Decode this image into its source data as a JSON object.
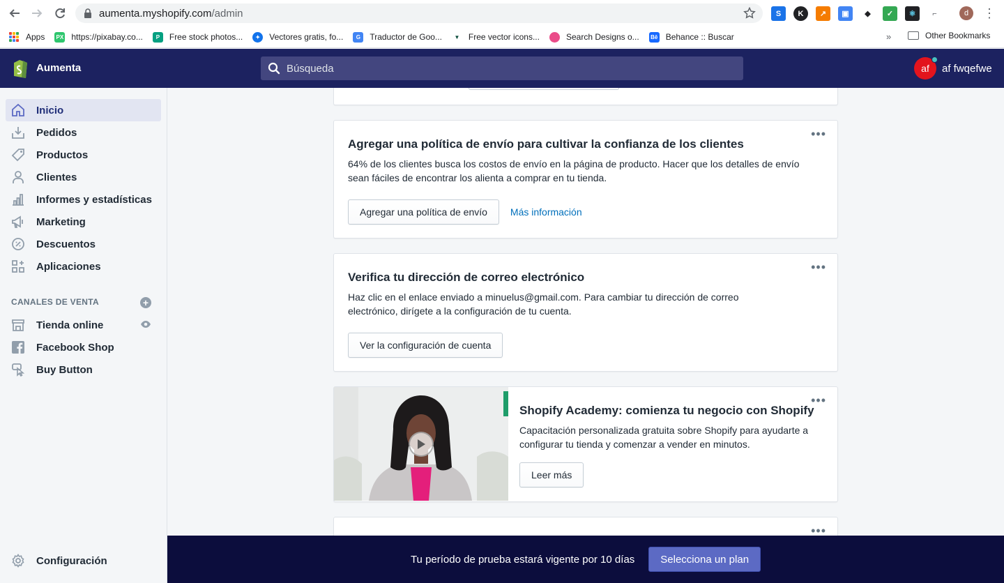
{
  "browser": {
    "url_host": "aumenta.myshopify.com",
    "url_path": "/admin",
    "profile_initial": "d",
    "bookmarks": [
      {
        "label": "Apps",
        "color": "#ea4335"
      },
      {
        "label": "https://pixabay.co...",
        "color": "#2ec66d",
        "glyph": "PX"
      },
      {
        "label": "Free stock photos...",
        "color": "#05a081",
        "glyph": "P"
      },
      {
        "label": "Vectores gratis, fo...",
        "color": "#1273eb",
        "glyph": "✦"
      },
      {
        "label": "Traductor de Goo...",
        "color": "#4285f4",
        "glyph": "G"
      },
      {
        "label": "Free vector icons...",
        "color": "#0b4d3c",
        "glyph": "▼"
      },
      {
        "label": "Search Designs o...",
        "color": "#ea4c89",
        "glyph": "●"
      },
      {
        "label": "Behance :: Buscar",
        "color": "#1769ff",
        "glyph": "Bē"
      }
    ],
    "more_bookmarks": "»",
    "other_bookmarks": "Other Bookmarks"
  },
  "topbar": {
    "store_name": "Aumenta",
    "search_placeholder": "Búsqueda",
    "user_initials": "af",
    "user_name": "af fwqefwe"
  },
  "sidebar": {
    "items": [
      {
        "label": "Inicio",
        "icon": "home-icon",
        "active": true
      },
      {
        "label": "Pedidos",
        "icon": "orders-icon"
      },
      {
        "label": "Productos",
        "icon": "tag-icon"
      },
      {
        "label": "Clientes",
        "icon": "person-icon"
      },
      {
        "label": "Informes y estadísticas",
        "icon": "bar-chart-icon"
      },
      {
        "label": "Marketing",
        "icon": "megaphone-icon"
      },
      {
        "label": "Descuentos",
        "icon": "discount-icon"
      },
      {
        "label": "Aplicaciones",
        "icon": "apps-icon"
      }
    ],
    "sales_channels_title": "CANALES DE VENTA",
    "channels": [
      {
        "label": "Tienda online",
        "icon": "store-icon"
      },
      {
        "label": "Facebook Shop",
        "icon": "facebook-icon"
      },
      {
        "label": "Buy Button",
        "icon": "buy-button-icon"
      }
    ],
    "settings_label": "Configuración"
  },
  "cards": {
    "shipping": {
      "title": "Agregar una política de envío para cultivar la confianza de los clientes",
      "body": "64% de los clientes busca los costos de envío en la página de producto. Hacer que los detalles de envío sean fáciles de encontrar los alienta a comprar en tu tienda.",
      "primary": "Agregar una política de envío",
      "link": "Más información"
    },
    "email": {
      "title": "Verifica tu dirección de correo electrónico",
      "body": "Haz clic en el enlace enviado a minuelus@gmail.com. Para cambiar tu dirección de correo electrónico, dirígete a la configuración de tu cuenta.",
      "primary": "Ver la configuración de cuenta"
    },
    "academy": {
      "title": "Shopify Academy: comienza tu negocio con Shopify",
      "body": "Capacitación personalizada gratuita sobre Shopify para ayudarte a configurar tu tienda y comenzar a vender en minutos.",
      "primary": "Leer más"
    },
    "more_actions": "•••"
  },
  "trial": {
    "message": "Tu período de prueba estará vigente por 10 días",
    "button": "Selecciona un plan"
  },
  "colors": {
    "topbar": "#1c2260",
    "accent": "#5c6ac4",
    "trial_bar": "#0c0d3d",
    "link": "#006fbb"
  }
}
